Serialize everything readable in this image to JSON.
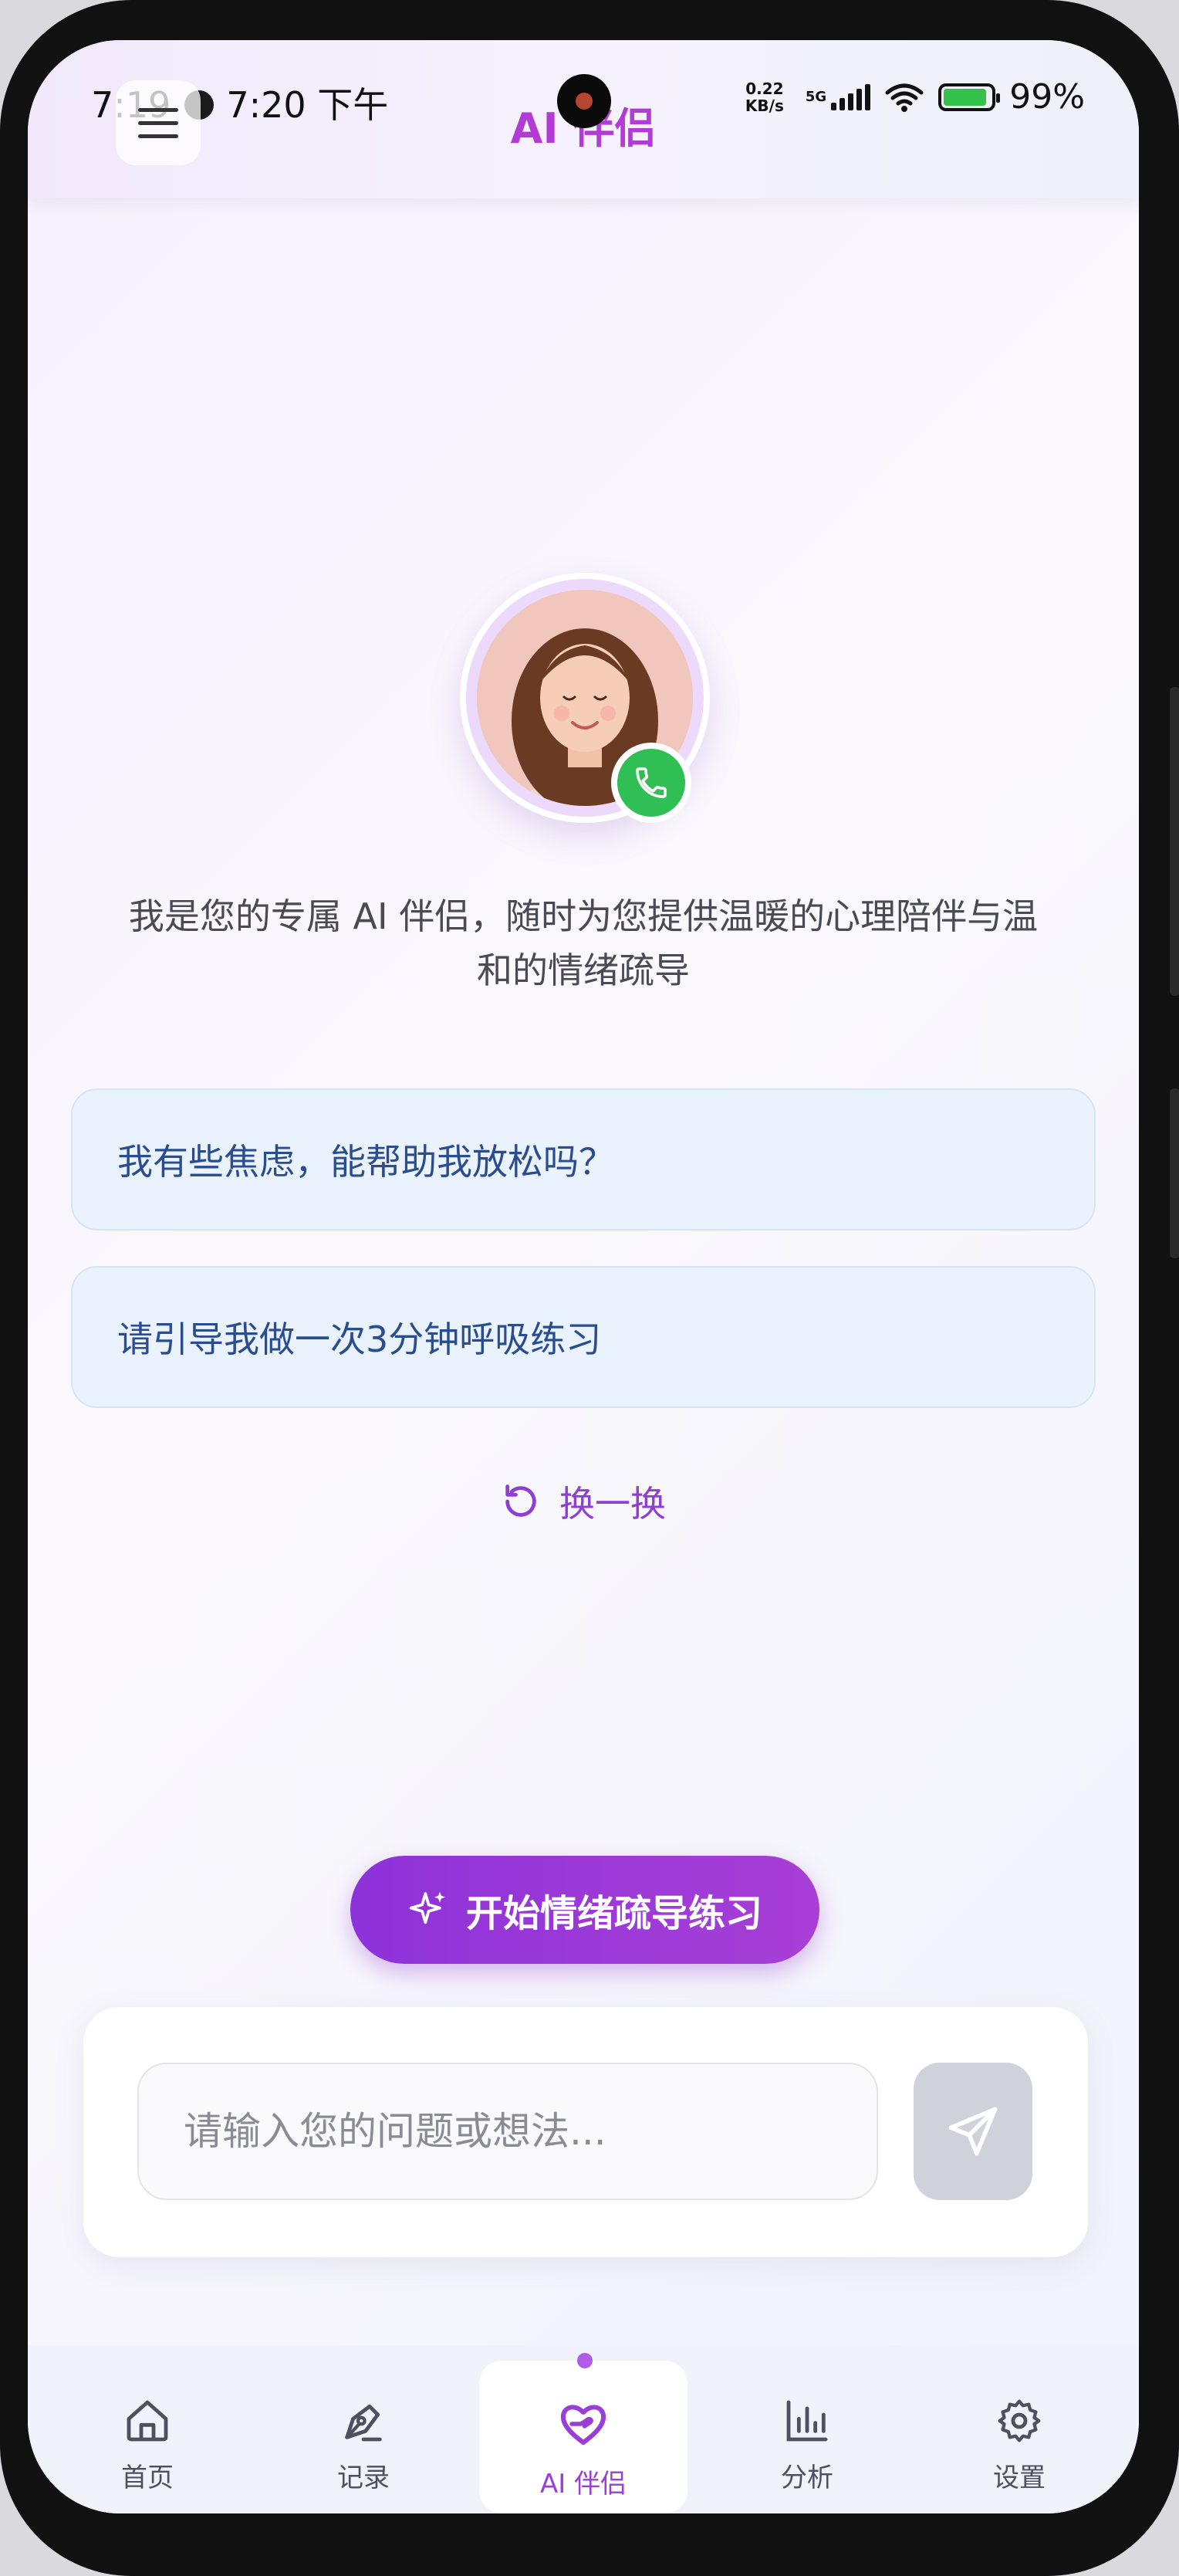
{
  "status_bar": {
    "time_left": "7:19",
    "time_clock": "7:20 下午",
    "net_speed": "0.22 KB/s",
    "network": "5G",
    "battery": "99%"
  },
  "header": {
    "title": "AI 伴侣",
    "menu_icon": "hamburger-menu-icon"
  },
  "companion": {
    "avatar": "companion-avatar",
    "call_icon": "phone-icon",
    "intro": "我是您的专属 AI 伴侣，随时为您提供温暖的心理陪伴与温和的情绪疏导"
  },
  "suggestions": [
    {
      "label": "我有些焦虑，能帮助我放松吗？"
    },
    {
      "label": "请引导我做一次3分钟呼吸练习"
    }
  ],
  "refresh": {
    "label": "换一换",
    "icon": "refresh-icon"
  },
  "cta": {
    "label": "开始情绪疏导练习",
    "icon": "sparkle-icon"
  },
  "input": {
    "placeholder": "请输入您的问题或想法...",
    "value": ""
  },
  "send": {
    "icon": "send-icon"
  },
  "tabs": [
    {
      "label": "首页",
      "icon": "home-icon"
    },
    {
      "label": "记录",
      "icon": "pen-icon"
    },
    {
      "label": "AI 伴侣",
      "icon": "heart-hand-icon"
    },
    {
      "label": "分析",
      "icon": "bar-chart-icon"
    },
    {
      "label": "设置",
      "icon": "gear-icon"
    }
  ],
  "colors": {
    "accent": "#9a3fd6",
    "cta_gradient_start": "#8d32d9",
    "suggestion_bg": "#e9f2fd",
    "suggestion_text": "#2a4d8f",
    "call_green": "#2fbf55"
  }
}
